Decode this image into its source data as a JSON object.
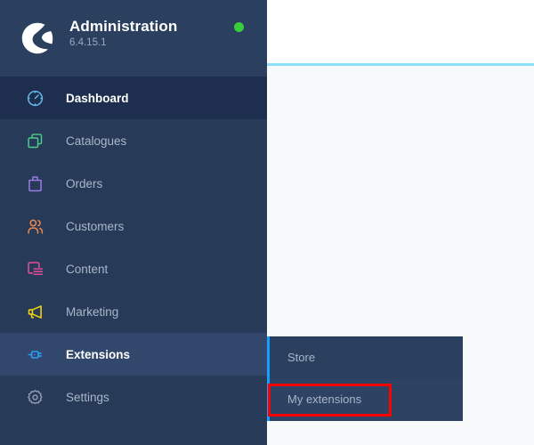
{
  "app": {
    "brand_title": "Administration",
    "version": "6.4.15.1",
    "logo_icon": "shopware-logo-icon",
    "status_dot_icon": "status-online-dot-icon",
    "status_color": "#37d03a"
  },
  "sidebar": {
    "background_color": "#273a58",
    "header_background_color": "#2b3f5f",
    "active_background_color": "#31476c",
    "items": [
      {
        "label": "Dashboard",
        "icon": "dashboard-gauge-icon",
        "icon_color": "#64b6e8",
        "state": "dashboard"
      },
      {
        "label": "Catalogues",
        "icon": "catalogues-copy-icon",
        "icon_color": "#4ecb8c",
        "state": "default"
      },
      {
        "label": "Orders",
        "icon": "orders-bag-icon",
        "icon_color": "#9a7ce6",
        "state": "default"
      },
      {
        "label": "Customers",
        "icon": "customers-people-icon",
        "icon_color": "#f08a4b",
        "state": "default"
      },
      {
        "label": "Content",
        "icon": "content-document-icon",
        "icon_color": "#ef4e9d",
        "state": "default"
      },
      {
        "label": "Marketing",
        "icon": "marketing-megaphone-icon",
        "icon_color": "#f5d413",
        "state": "default"
      },
      {
        "label": "Extensions",
        "icon": "extensions-plug-icon",
        "icon_color": "#2f9cf4",
        "state": "active"
      },
      {
        "label": "Settings",
        "icon": "settings-gear-icon",
        "icon_color": "#8e9bb0",
        "state": "default"
      }
    ]
  },
  "flyout": {
    "accent_color": "#189eff",
    "items": [
      {
        "label": "Store"
      },
      {
        "label": "My extensions"
      }
    ]
  },
  "annotation": {
    "target": "My extensions",
    "color": "#ff0000"
  },
  "content": {
    "topbar_border_color": "#8ee0f5",
    "background_color": "#f8f9fb"
  }
}
